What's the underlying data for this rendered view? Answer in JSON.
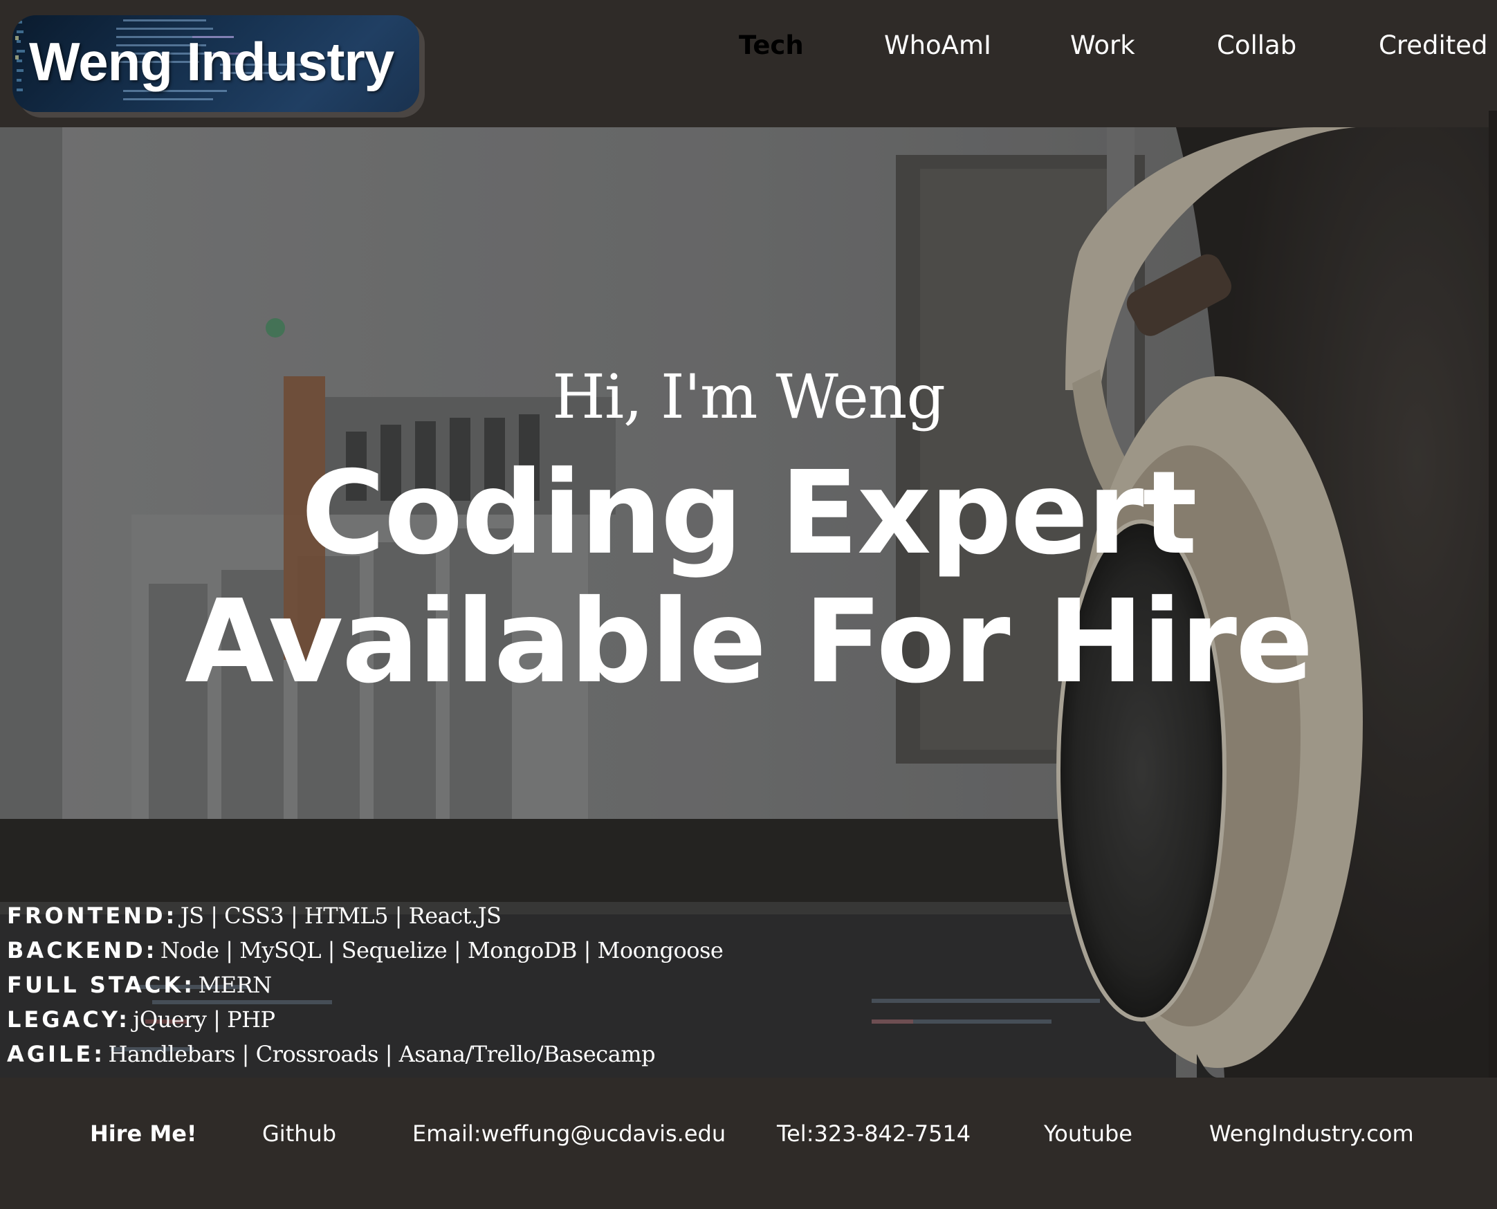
{
  "logo": {
    "text": "Weng Industry"
  },
  "nav": {
    "items": [
      {
        "label": "Tech",
        "active": true
      },
      {
        "label": "WhoAmI"
      },
      {
        "label": "Work"
      },
      {
        "label": "Collab"
      },
      {
        "label": "Credited"
      }
    ]
  },
  "hero": {
    "greeting": "Hi, I'm Weng",
    "headline_line1": "Coding Expert",
    "headline_line2": "Available For Hire"
  },
  "skills": [
    {
      "label": "FRONTEND:",
      "items": "JS | CSS3 | HTML5 | React.JS"
    },
    {
      "label": "BACKEND:",
      "items": "Node | MySQL | Sequelize | MongoDB | Moongoose"
    },
    {
      "label": "FULL STACK:",
      "items": "MERN"
    },
    {
      "label": "LEGACY:",
      "items": "jQuery | PHP"
    },
    {
      "label": "AGILE:",
      "items": "Handlebars | Crossroads | Asana/Trello/Basecamp"
    }
  ],
  "footer": {
    "links": [
      {
        "label": "Hire Me!"
      },
      {
        "label": "Github"
      },
      {
        "label": "Email:weffung@ucdavis.edu"
      },
      {
        "label": "Tel:323-842-7514"
      },
      {
        "label": "Youtube"
      },
      {
        "label": "WengIndustry.com"
      }
    ]
  },
  "colors": {
    "header_bg": "#2f2b28",
    "text": "#ffffff",
    "active_nav": "#000000"
  }
}
